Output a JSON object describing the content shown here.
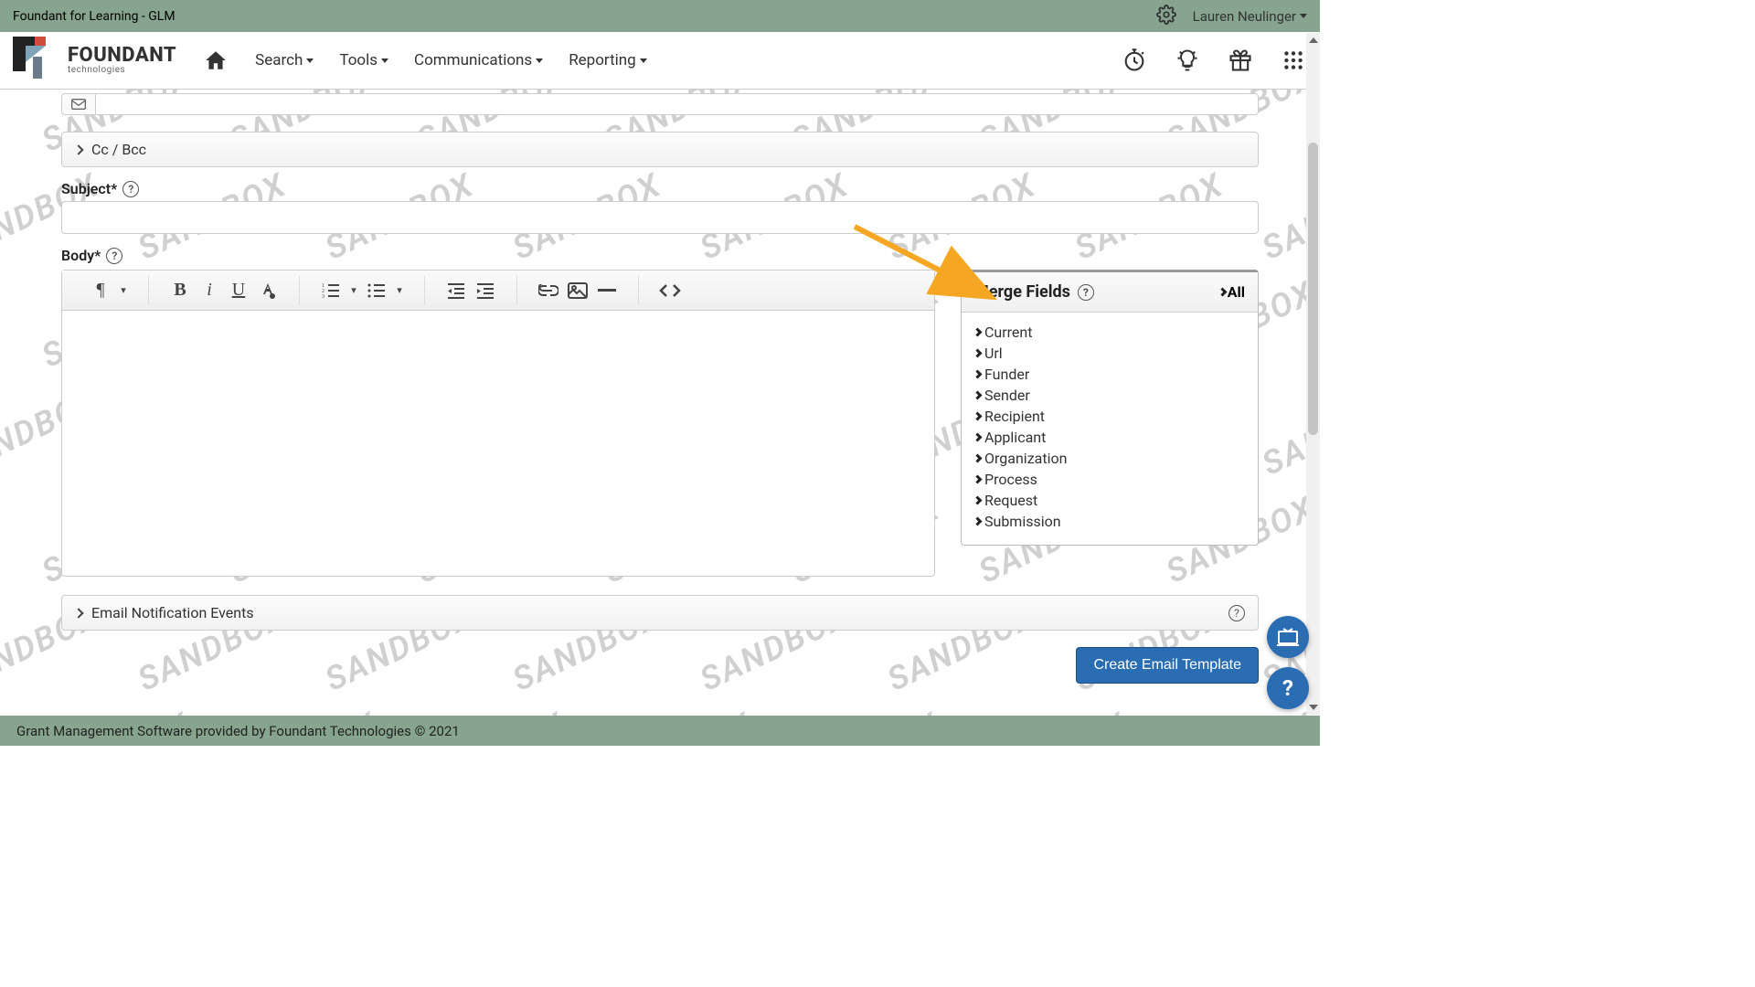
{
  "topbar": {
    "title": "Foundant for Learning - GLM",
    "user": "Lauren Neulinger"
  },
  "nav": {
    "logo_main": "FOUNDANT",
    "logo_sub": "technologies",
    "items": [
      "Search",
      "Tools",
      "Communications",
      "Reporting"
    ]
  },
  "form": {
    "cc_label": "Cc / Bcc",
    "subject_label": "Subject*",
    "body_label": "Body*",
    "events_label": "Email Notification Events",
    "create_btn": "Create Email Template"
  },
  "merge": {
    "title": "Merge Fields",
    "all": "All",
    "items": [
      "Current",
      "Url",
      "Funder",
      "Sender",
      "Recipient",
      "Applicant",
      "Organization",
      "Process",
      "Request",
      "Submission"
    ]
  },
  "footer": {
    "text": "Grant Management Software provided by Foundant Technologies © 2021"
  },
  "watermark": "SANDBOX"
}
